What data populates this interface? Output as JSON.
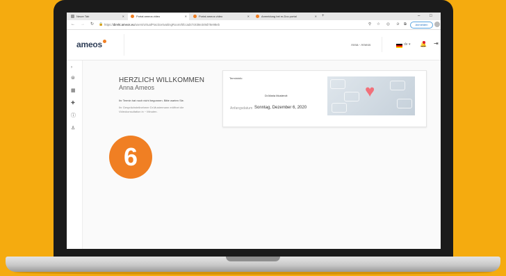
{
  "browser": {
    "tabs": [
      {
        "label": "Neuer Tab"
      },
      {
        "label": "Portal ameos video"
      },
      {
        "label": "Portal ameos video"
      },
      {
        "label": "Anmeldung bei m-Doc portal"
      }
    ],
    "url_prefix": "https://",
    "url_domain": "direkt.ameos.eu",
    "url_path": "/users/virtualPractice/waitingRoom/5fccad47c838e349d78e98eb",
    "signin_label": "Anmelden"
  },
  "header": {
    "logo": "ameos",
    "user_name": "Anna - Ameos",
    "language": "de"
  },
  "welcome": {
    "title": "HERZLICH WILLKOMMEN",
    "name": "Anna Ameos",
    "status_message": "Ihr Termin hat noch nicht begonnen. Bitte warten Sie.",
    "info_message": "Ihr Gesprächsteilnehmer Dr.Mustermann eröffnet die Videokonsultation in ~ Minuten."
  },
  "appointment": {
    "card_title": "Termininfo",
    "doctor": "Dr.Maria Mustercit",
    "date_label": "Anfangsdatum",
    "date_value": "Sonntag, Dezember 6, 2020"
  },
  "step_badge": "6",
  "colors": {
    "background": "#f5ab0f",
    "accent": "#f07f23",
    "brand_navy": "#2f3e57"
  }
}
